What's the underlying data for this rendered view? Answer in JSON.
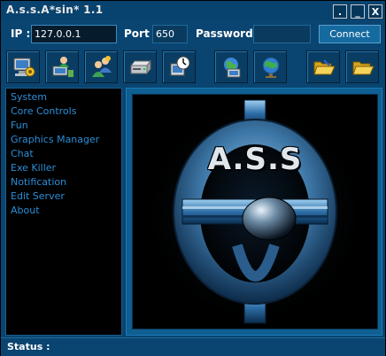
{
  "window": {
    "title": "A.s.s.A*sin* 1.1"
  },
  "title_buttons": {
    "dot": ".",
    "minimize": "_",
    "close": "X"
  },
  "connection": {
    "ip_label": "IP :",
    "ip_value": "127.0.0.1",
    "port_label": "Port :",
    "port_value": "650",
    "password_label": "Password :",
    "password_value": "",
    "connect_label": "Connect"
  },
  "toolbar": [
    {
      "icon": "computer-settings-icon"
    },
    {
      "icon": "network-user-icon"
    },
    {
      "icon": "users-icon"
    },
    {
      "icon": "drive-icon"
    },
    {
      "icon": "clock-settings-icon"
    },
    {
      "icon": "network-computer-icon"
    },
    {
      "icon": "globe-icon"
    },
    {
      "icon": "open-folder-icon"
    },
    {
      "icon": "open-folder-icon"
    }
  ],
  "sidebar": {
    "items": [
      {
        "label": "System"
      },
      {
        "label": "Core Controls"
      },
      {
        "label": "Fun"
      },
      {
        "label": "Graphics Manager"
      },
      {
        "label": "Chat"
      },
      {
        "label": "Exe Killer"
      },
      {
        "label": "Notification"
      },
      {
        "label": "Edit Server"
      },
      {
        "label": "About"
      }
    ]
  },
  "logo": {
    "text": "A.S.S"
  },
  "status": {
    "label": "Status :",
    "value": ""
  },
  "colors": {
    "background": "#0a4470",
    "menu_text": "#2a8ed8",
    "panel": "#0f5f92"
  }
}
